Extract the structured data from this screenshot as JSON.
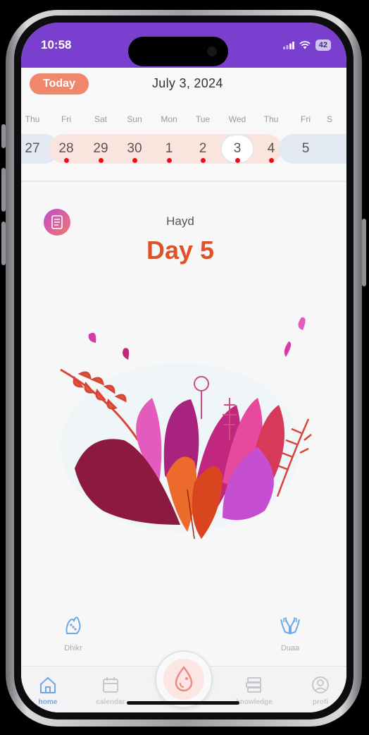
{
  "status": {
    "time": "10:58",
    "battery": "42"
  },
  "header": {
    "today_label": "Today",
    "date_title": "July 3, 2024"
  },
  "week": {
    "weekdays": [
      "Thu",
      "Fri",
      "Sat",
      "Sun",
      "Mon",
      "Tue",
      "Wed",
      "Thu",
      "Fri",
      "S"
    ],
    "days": [
      "27",
      "28",
      "29",
      "30",
      "1",
      "2",
      "3",
      "4",
      "5"
    ],
    "marked_days": [
      "28",
      "29",
      "30",
      "1",
      "2",
      "3",
      "4"
    ],
    "selected_day": "3"
  },
  "main": {
    "phase_label": "Hayd",
    "day_label": "Day 5"
  },
  "quick": {
    "dhikr_label": "Dhikr",
    "duaa_label": "Duaa"
  },
  "tabs": {
    "home": "home",
    "calendar": "calendar",
    "knowledge": "knowledge",
    "profile": "profi"
  },
  "colors": {
    "status_bar": "#7b3fd0",
    "today_button": "#f0866a",
    "day_text": "#e0512a",
    "period_dot": "#e8111b",
    "active_tab": "#6ea8e6"
  }
}
